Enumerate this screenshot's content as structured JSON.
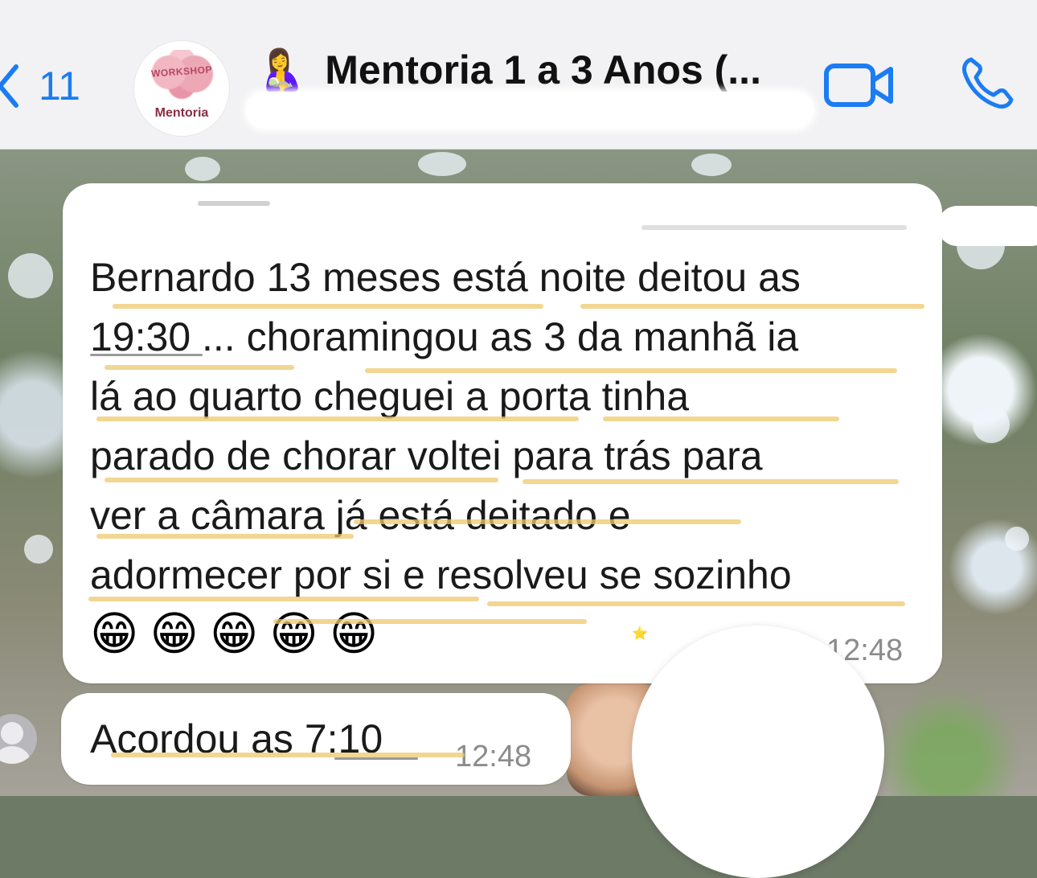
{
  "header": {
    "back_count": "11",
    "avatar": {
      "badge_text": "WORKSHOP",
      "label": "Mentoria"
    },
    "title_emoji": "🤱",
    "title": "Mentoria 1 a 3 Anos (..."
  },
  "messages": [
    {
      "lines": [
        "Bernardo 13 meses está noite deitou as",
        "19:30 ... choramingou as 3 da manhã ia",
        "lá ao quarto cheguei a porta tinha",
        "parado de chorar voltei para trás para",
        "ver a câmara já está deitado e",
        "adormecer por si e resolveu se sozinho"
      ],
      "emojis": [
        "😁",
        "😁",
        "😁",
        "😁",
        "😁"
      ],
      "time": "12:48"
    },
    {
      "lines": [
        "Acordou as 7:10"
      ],
      "time": "12:48"
    }
  ],
  "reaction": "⭐",
  "colors": {
    "accent": "#1c7cf3",
    "highlight": "#eec86e",
    "bubble": "#ffffff"
  }
}
